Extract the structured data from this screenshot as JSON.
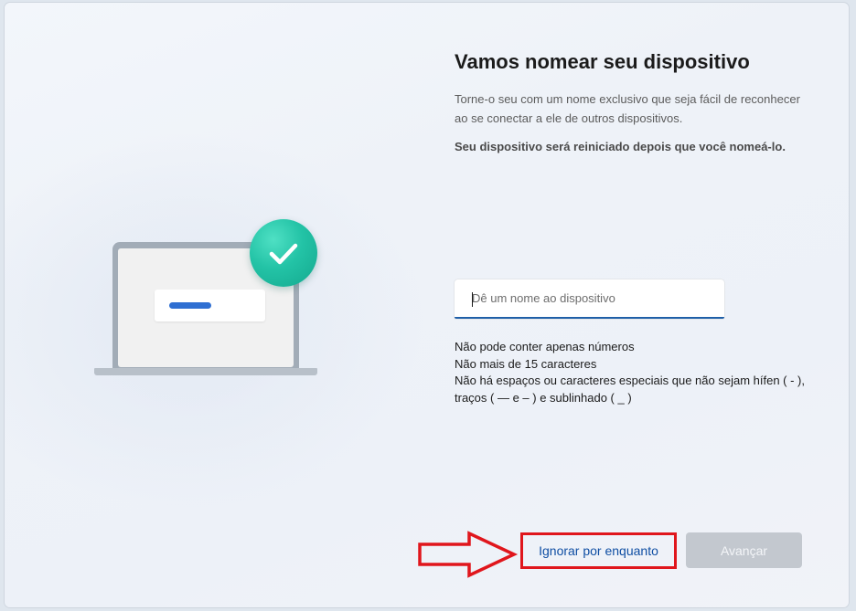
{
  "page": {
    "title": "Vamos nomear seu dispositivo",
    "description": "Torne-o seu com um nome exclusivo que seja fácil de reconhecer ao se conectar a ele de outros dispositivos.",
    "warning": "Seu dispositivo será reiniciado depois que você nomeá-lo."
  },
  "name_field": {
    "placeholder": "Dê um nome ao dispositivo",
    "value": ""
  },
  "rules": [
    "Não pode conter apenas números",
    "Não mais de 15 caracteres",
    "Não há espaços ou caracteres especiais que não sejam hífen ( - ), traços ( — e – ) e sublinhado ( _ )"
  ],
  "buttons": {
    "skip_label": "Ignorar por enquanto",
    "next_label": "Avançar"
  },
  "icons": {
    "illustration": "laptop-illustration",
    "badge": "checkmark-icon",
    "annotation": "red-arrow-annotation"
  },
  "colors": {
    "accent": "#1f5fa8",
    "check_badge": "#23c3a6",
    "annotation_red": "#e0161c",
    "disabled_button": "#c3c8cf"
  }
}
